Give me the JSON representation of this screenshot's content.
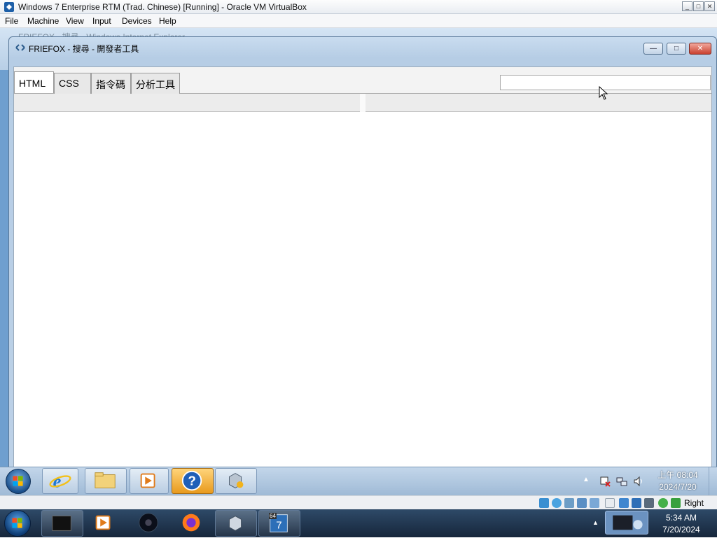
{
  "host_window": {
    "title": "Windows 7 Enterprise RTM (Trad. Chinese) [Running] - Oracle VM VirtualBox",
    "menu": [
      "File",
      "Machine",
      "View",
      "Input",
      "Devices",
      "Help"
    ],
    "controls": {
      "minimize": "_",
      "maximize": "□",
      "close": "✕"
    }
  },
  "behind_window": {
    "title_fragment": "FRIEFOX - 搜尋 - Windows Internet Explorer"
  },
  "devtools": {
    "title": "FRIEFOX - 搜尋 - 開發者工具",
    "tabs": [
      {
        "label": "HTML",
        "active": true
      },
      {
        "label": "CSS",
        "active": false
      },
      {
        "label": "指令碼",
        "active": false
      },
      {
        "label": "分析工具",
        "active": false
      }
    ],
    "search": {
      "value": "",
      "placeholder": ""
    },
    "controls": {
      "minimize": "—",
      "maximize": "□",
      "close": "✕"
    }
  },
  "guest_taskbar": {
    "items": [
      "start-orb",
      "internet-explorer-icon",
      "windows-explorer-icon",
      "media-player-icon",
      "help-icon",
      "virtualbox-icon"
    ],
    "active_item": "help-icon",
    "clock": {
      "time": "上午 08:04",
      "date": "2024/7/20"
    }
  },
  "vb_status": {
    "host_key": "Right Ctrl"
  },
  "host_taskbar": {
    "items": [
      "start-orb",
      "terminal-icon",
      "media-player-icon",
      "obs-icon",
      "firefox-icon",
      "virtualbox-icon",
      "win7-vm-icon"
    ],
    "vm_badge": "64",
    "clock": {
      "time": "5:34 AM",
      "date": "7/20/2024"
    }
  },
  "colors": {
    "aero_accent": "#6f9fcf",
    "close_red": "#c9412f",
    "active_task": "#e89a1d"
  }
}
